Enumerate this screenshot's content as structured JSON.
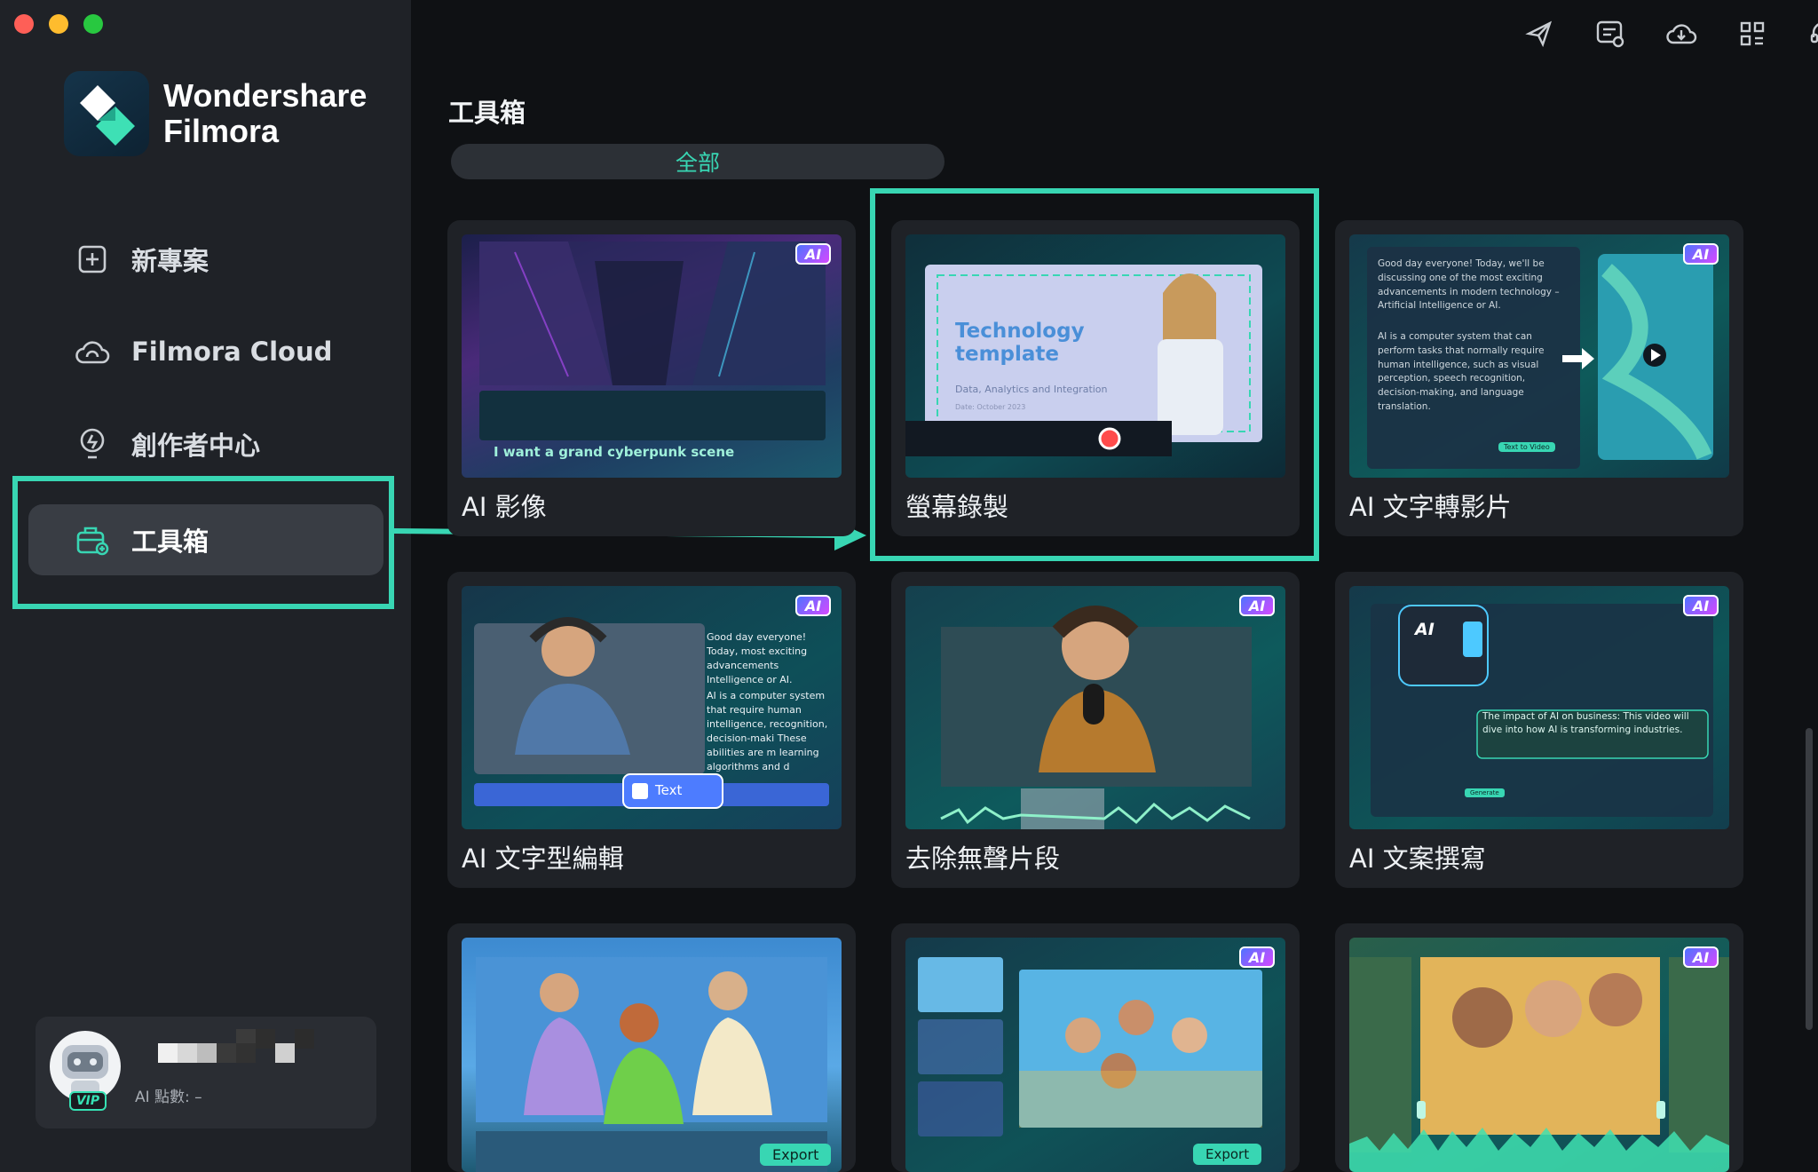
{
  "app": {
    "name_line1": "Wondershare",
    "name_line2": "Filmora"
  },
  "sidebar": {
    "items": [
      {
        "label": "新專案",
        "icon": "new-project-icon"
      },
      {
        "label": "Filmora Cloud",
        "icon": "cloud-icon"
      },
      {
        "label": "創作者中心",
        "icon": "lightbulb-icon"
      },
      {
        "label": "工具箱",
        "icon": "toolbox-icon",
        "active": true
      }
    ]
  },
  "user": {
    "badge": "VIP",
    "ai_points_label": "AI 點數: –"
  },
  "top_icons": [
    "send-feedback-icon",
    "messages-icon",
    "cloud-download-icon",
    "apps-grid-icon",
    "headset-support-icon"
  ],
  "main": {
    "title": "工具箱",
    "filter_tab": "全部",
    "cards": [
      {
        "title": "AI 影像",
        "ai": true,
        "thumb_text": "I want a grand cyberpunk scene"
      },
      {
        "title": "螢幕錄製",
        "ai": false,
        "thumb_heading_1": "Technology",
        "thumb_heading_2": "template",
        "thumb_sub": "Data, Analytics and Integration",
        "thumb_date": "Date: October 2023"
      },
      {
        "title": "AI 文字轉影片",
        "ai": true,
        "thumb_para1": "Good day everyone! Today, we'll be discussing one of the most exciting advancements in modern technology – Artificial Intelligence or AI.",
        "thumb_para2": "AI is a computer system that can perform tasks that normally require human intelligence, such as visual perception, speech recognition, decision-making, and language translation.",
        "thumb_button": "Text to Video"
      },
      {
        "title": "AI 文字型編輯",
        "ai": true,
        "thumb_para1": "Good day everyone! Today, most exciting advancements Intelligence or AI.",
        "thumb_para2": "AI is a computer system that require human intelligence, recognition, decision-maki These abilities are m learning algorithms and d continuously learn and adap",
        "thumb_chip": "Text",
        "thumb_small_chip": "Text"
      },
      {
        "title": "去除無聲片段",
        "ai": true
      },
      {
        "title": "AI 文案撰寫",
        "ai": true,
        "thumb_ai": "AI",
        "thumb_caption": "The impact of AI on business: This video will dive into how AI is transforming industries.",
        "thumb_button": "Generate"
      },
      {
        "title": "",
        "ai": false,
        "thumb_button": "Export"
      },
      {
        "title": "",
        "ai": true,
        "thumb_button": "Export"
      },
      {
        "title": "",
        "ai": true
      }
    ]
  },
  "colors": {
    "accent": "#38d6b3",
    "sidebar_bg": "#1f2227",
    "main_bg": "#0f1114"
  }
}
